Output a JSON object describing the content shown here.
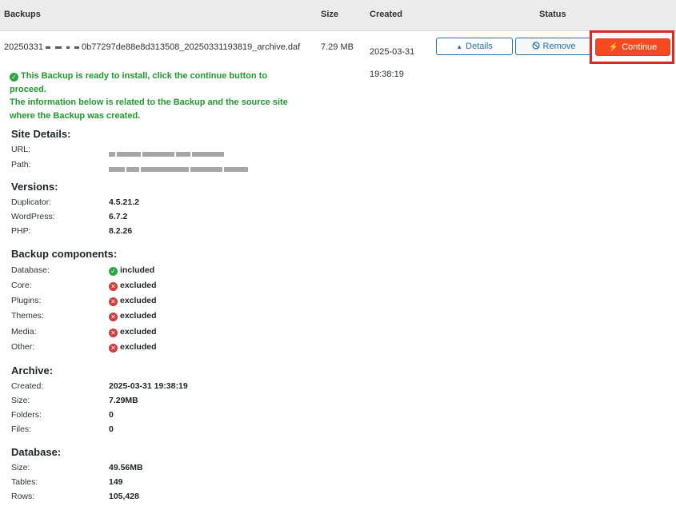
{
  "table": {
    "headers": {
      "backups": "Backups",
      "size": "Size",
      "created": "Created",
      "status": "Status"
    },
    "row": {
      "name_prefix": "20250331",
      "name_suffix": "0b77297de88e8d313508_20250331193819_archive.daf",
      "size": "7.29 MB",
      "created_date": "2025-03-31",
      "created_time": "19:38:19"
    },
    "buttons": {
      "details": "Details",
      "remove": "Remove",
      "continue": "Continue"
    }
  },
  "message": {
    "line1": "This Backup is ready to install, click the continue button to proceed.",
    "line2": "The information below is related to the Backup and the source site",
    "line3": "where the Backup was created."
  },
  "site_details": {
    "title": "Site Details:",
    "url_label": "URL:",
    "path_label": "Path:"
  },
  "versions": {
    "title": "Versions:",
    "items": [
      {
        "label": "Duplicator:",
        "value": "4.5.21.2"
      },
      {
        "label": "WordPress:",
        "value": "6.7.2"
      },
      {
        "label": "PHP:",
        "value": "8.2.26"
      }
    ]
  },
  "components": {
    "title": "Backup components:",
    "items": [
      {
        "label": "Database:",
        "value": "included",
        "status": "included"
      },
      {
        "label": "Core:",
        "value": "excluded",
        "status": "excluded"
      },
      {
        "label": "Plugins:",
        "value": "excluded",
        "status": "excluded"
      },
      {
        "label": "Themes:",
        "value": "excluded",
        "status": "excluded"
      },
      {
        "label": "Media:",
        "value": "excluded",
        "status": "excluded"
      },
      {
        "label": "Other:",
        "value": "excluded",
        "status": "excluded"
      }
    ]
  },
  "archive": {
    "title": "Archive:",
    "items": [
      {
        "label": "Created:",
        "value": "2025-03-31 19:38:19"
      },
      {
        "label": "Size:",
        "value": "7.29MB"
      },
      {
        "label": "Folders:",
        "value": "0"
      },
      {
        "label": "Files:",
        "value": "0"
      }
    ]
  },
  "database": {
    "title": "Database:",
    "items": [
      {
        "label": "Size:",
        "value": "49.56MB"
      },
      {
        "label": "Tables:",
        "value": "149"
      },
      {
        "label": "Rows:",
        "value": "105,428"
      }
    ]
  },
  "colors": {
    "accent": "#2271b1",
    "continue": "#f54a1f",
    "success": "#1f9a2c",
    "highlight": "#e0261d"
  }
}
